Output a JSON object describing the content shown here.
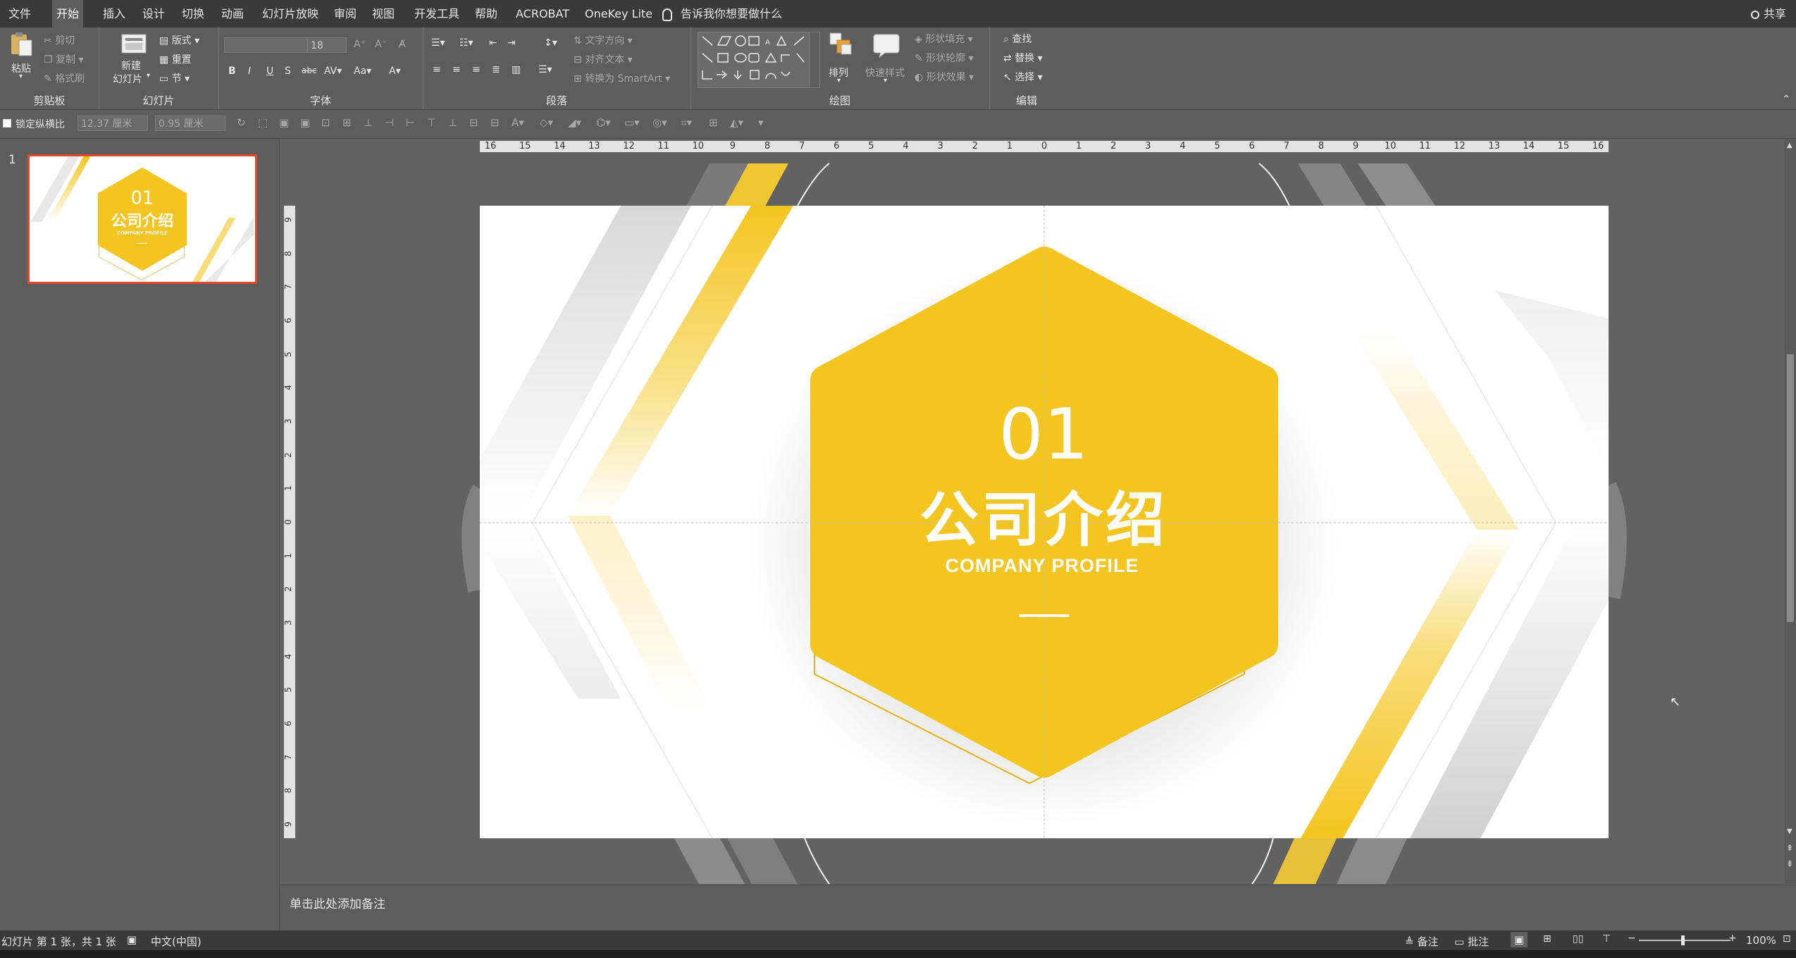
{
  "tabs": [
    "文件",
    "开始",
    "插入",
    "设计",
    "切换",
    "动画",
    "幻灯片放映",
    "审阅",
    "视图",
    "开发工具",
    "帮助",
    "ACROBAT",
    "OneKey Lite"
  ],
  "active_tab": "开始",
  "tell_me": "告诉我你想要做什么",
  "share": "共享",
  "ribbon": {
    "clipboard": {
      "label": "剪贴板",
      "paste": "粘贴",
      "cut": "剪切",
      "copy": "复制",
      "format_painter": "格式刷"
    },
    "slides": {
      "label": "幻灯片",
      "new_slide_1": "新建",
      "new_slide_2": "幻灯片",
      "layout": "版式",
      "reset": "重置",
      "section": "节"
    },
    "font": {
      "label": "字体",
      "font_size": "18"
    },
    "paragraph": {
      "label": "段落",
      "text_direction": "文字方向",
      "align_text": "对齐文本",
      "convert_smartart": "转换为 SmartArt"
    },
    "drawing": {
      "label": "绘图",
      "arrange": "排列",
      "quick_styles": "快速样式",
      "shape_fill": "形状填充",
      "shape_outline": "形状轮廓",
      "shape_effects": "形状效果"
    },
    "editing": {
      "label": "编辑",
      "find": "查找",
      "replace": "替换",
      "select": "选择"
    }
  },
  "format_bar": {
    "lock_aspect": "锁定纵横比",
    "height": "12.37 厘米",
    "width": "0.95 厘米"
  },
  "slide_panel": {
    "slide_number": "1"
  },
  "slide": {
    "number": "01",
    "title": "公司介绍",
    "subtitle": "COMPANY PROFILE"
  },
  "ruler_h": [
    "16",
    "15",
    "14",
    "13",
    "12",
    "11",
    "10",
    "9",
    "8",
    "7",
    "6",
    "5",
    "4",
    "3",
    "2",
    "1",
    "0",
    "1",
    "2",
    "3",
    "4",
    "5",
    "6",
    "7",
    "8",
    "9",
    "10",
    "11",
    "12",
    "13",
    "14",
    "15",
    "16"
  ],
  "ruler_v": [
    "9",
    "8",
    "7",
    "6",
    "5",
    "4",
    "3",
    "2",
    "1",
    "0",
    "1",
    "2",
    "3",
    "4",
    "5",
    "6",
    "7",
    "8",
    "9"
  ],
  "notes_placeholder": "单击此处添加备注",
  "status": {
    "slide_info": "幻灯片 第 1 张，共 1 张",
    "language": "中文(中国)",
    "notes": "备注",
    "comments": "批注",
    "zoom": "100%"
  },
  "colors": {
    "accent": "#F4C51F",
    "chrome_dark": "#3a3a3a",
    "chrome": "#5d5d5d",
    "selection": "#e0492c"
  }
}
